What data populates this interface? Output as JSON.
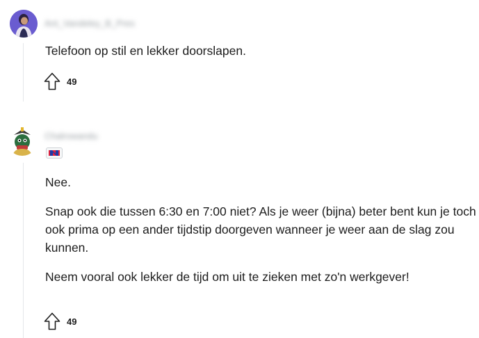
{
  "comments": [
    {
      "username": "Ant_Vandeley_B_Pres",
      "paragraphs": [
        "Telefoon op stil en lekker doorslapen."
      ],
      "votes": "49"
    },
    {
      "username": "Chalrowandu",
      "paragraphs": [
        "Nee.",
        "Snap ook die tussen 6:30 en 7:00 niet? Als je weer (bijna) beter bent kun je toch ook prima op een ander tijdstip doorgeven wanneer je weer aan de slag zou kunnen.",
        "Neem vooral ook lekker de tijd om uit te zieken met zo'n werkgever!"
      ],
      "votes": "49"
    }
  ],
  "icons": {
    "vote": "upvote-arrow-icon",
    "flair": "flag-flair-icon"
  },
  "colors": {
    "thread_line": "#e5e7e9",
    "flair_red": "#e4203a",
    "flair_blue": "#1c3aa9"
  }
}
